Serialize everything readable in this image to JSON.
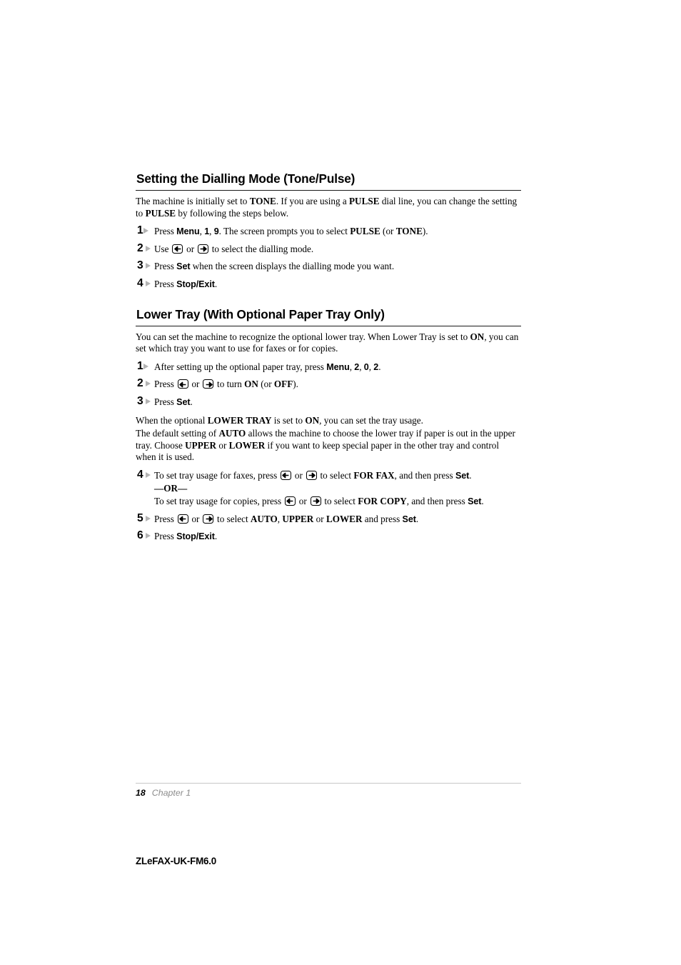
{
  "document": {
    "id_line": "ZLeFAX-UK-FM6.0",
    "footer": {
      "page_number": "18",
      "chapter": "Chapter 1"
    }
  },
  "sections": [
    {
      "heading": "Setting the Dialling Mode (Tone/Pulse)",
      "intro": [
        {
          "parts": [
            {
              "t": "The machine is initially set to ",
              "s": "normal"
            },
            {
              "t": "TONE",
              "s": "bold-serif"
            },
            {
              "t": ". If you are using a ",
              "s": "normal"
            },
            {
              "t": "PULSE",
              "s": "bold-serif"
            },
            {
              "t": " dial line, you can change the setting to ",
              "s": "normal"
            },
            {
              "t": "PULSE",
              "s": "bold-serif"
            },
            {
              "t": " by following the steps below.",
              "s": "normal"
            }
          ]
        }
      ],
      "steps": [
        {
          "num": "1",
          "parts": [
            {
              "t": "Press ",
              "s": "normal"
            },
            {
              "t": "Menu",
              "s": "bold-sans"
            },
            {
              "t": ", ",
              "s": "normal"
            },
            {
              "t": "1",
              "s": "bold-sans"
            },
            {
              "t": ", ",
              "s": "normal"
            },
            {
              "t": "9",
              "s": "bold-sans"
            },
            {
              "t": ". The screen prompts you to select ",
              "s": "normal"
            },
            {
              "t": "PULSE",
              "s": "bold-serif"
            },
            {
              "t": " (or ",
              "s": "normal"
            },
            {
              "t": "TONE",
              "s": "bold-serif"
            },
            {
              "t": ").",
              "s": "normal"
            }
          ]
        },
        {
          "num": "2",
          "parts": [
            {
              "t": "Use ",
              "s": "normal"
            },
            {
              "t": "",
              "s": "key-left"
            },
            {
              "t": " or ",
              "s": "normal"
            },
            {
              "t": "",
              "s": "key-right"
            },
            {
              "t": " to select the dialling mode.",
              "s": "normal"
            }
          ]
        },
        {
          "num": "3",
          "parts": [
            {
              "t": "Press ",
              "s": "normal"
            },
            {
              "t": "Set",
              "s": "bold-sans"
            },
            {
              "t": " when the screen displays the dialling mode you want.",
              "s": "normal"
            }
          ]
        },
        {
          "num": "4",
          "parts": [
            {
              "t": "Press ",
              "s": "normal"
            },
            {
              "t": "Stop/Exit",
              "s": "bold-sans"
            },
            {
              "t": ".",
              "s": "normal"
            }
          ]
        }
      ]
    },
    {
      "heading": "Lower Tray (With Optional Paper Tray Only)",
      "intro": [
        {
          "parts": [
            {
              "t": "You can set the machine to recognize the optional lower tray. When Lower Tray is set to",
              "s": "normal"
            },
            {
              "t": " ON",
              "s": "bold-serif"
            },
            {
              "t": ", you can set which tray you want to use for faxes or for copies.",
              "s": "normal"
            }
          ]
        }
      ],
      "steps": [
        {
          "num": "1",
          "parts": [
            {
              "t": "After setting up the optional paper tray, press ",
              "s": "normal"
            },
            {
              "t": "Menu",
              "s": "bold-sans"
            },
            {
              "t": ", ",
              "s": "normal"
            },
            {
              "t": "2",
              "s": "bold-sans"
            },
            {
              "t": ", ",
              "s": "normal"
            },
            {
              "t": "0",
              "s": "bold-sans"
            },
            {
              "t": ", ",
              "s": "normal"
            },
            {
              "t": "2",
              "s": "bold-sans"
            },
            {
              "t": ".",
              "s": "normal"
            }
          ]
        },
        {
          "num": "2",
          "parts": [
            {
              "t": "Press ",
              "s": "normal"
            },
            {
              "t": "",
              "s": "key-left"
            },
            {
              "t": " or ",
              "s": "normal"
            },
            {
              "t": "",
              "s": "key-right"
            },
            {
              "t": " to turn ",
              "s": "normal"
            },
            {
              "t": "ON",
              "s": "bold-serif"
            },
            {
              "t": " (or ",
              "s": "normal"
            },
            {
              "t": "OFF",
              "s": "bold-serif"
            },
            {
              "t": ").",
              "s": "normal"
            }
          ]
        },
        {
          "num": "3",
          "parts": [
            {
              "t": "Press ",
              "s": "normal"
            },
            {
              "t": "Set",
              "s": "bold-sans"
            },
            {
              "t": ".",
              "s": "normal"
            }
          ]
        }
      ],
      "mid_paragraphs": [
        {
          "parts": [
            {
              "t": "When the optional ",
              "s": "normal"
            },
            {
              "t": "LOWER TRAY",
              "s": "bold-serif"
            },
            {
              "t": " is set to ",
              "s": "normal"
            },
            {
              "t": "ON",
              "s": "bold-serif"
            },
            {
              "t": ", you can set the tray usage.",
              "s": "normal"
            }
          ]
        },
        {
          "parts": [
            {
              "t": "The default setting of ",
              "s": "normal"
            },
            {
              "t": "AUTO",
              "s": "bold-serif"
            },
            {
              "t": " allows the machine to choose the lower tray if paper is out in the upper tray. Choose ",
              "s": "normal"
            },
            {
              "t": "UPPER",
              "s": "bold-serif"
            },
            {
              "t": " or ",
              "s": "normal"
            },
            {
              "t": "LOWER",
              "s": "bold-serif"
            },
            {
              "t": " if you want to keep special paper in the other tray and control when it is used.",
              "s": "normal"
            }
          ]
        }
      ],
      "steps2": [
        {
          "num": "4",
          "parts": [
            {
              "t": "To set tray usage for faxes, press ",
              "s": "normal"
            },
            {
              "t": "",
              "s": "key-left"
            },
            {
              "t": " or ",
              "s": "normal"
            },
            {
              "t": "",
              "s": "key-right"
            },
            {
              "t": " to select ",
              "s": "normal"
            },
            {
              "t": "FOR FAX",
              "s": "bold-serif"
            },
            {
              "t": ", and then press ",
              "s": "normal"
            },
            {
              "t": "Set",
              "s": "bold-sans"
            },
            {
              "t": ".",
              "s": "normal"
            }
          ],
          "or_label": "—OR—",
          "sub_parts": [
            {
              "t": "To set tray usage for copies, press ",
              "s": "normal"
            },
            {
              "t": "",
              "s": "key-left"
            },
            {
              "t": " or ",
              "s": "normal"
            },
            {
              "t": "",
              "s": "key-right"
            },
            {
              "t": " to select ",
              "s": "normal"
            },
            {
              "t": "FOR COPY",
              "s": "bold-serif"
            },
            {
              "t": ", and then press ",
              "s": "normal"
            },
            {
              "t": "Set",
              "s": "bold-sans"
            },
            {
              "t": ".",
              "s": "normal"
            }
          ]
        },
        {
          "num": "5",
          "parts": [
            {
              "t": "Press ",
              "s": "normal"
            },
            {
              "t": "",
              "s": "key-left"
            },
            {
              "t": " or ",
              "s": "normal"
            },
            {
              "t": "",
              "s": "key-right"
            },
            {
              "t": " to select ",
              "s": "normal"
            },
            {
              "t": "AUTO",
              "s": "bold-serif"
            },
            {
              "t": ", ",
              "s": "normal"
            },
            {
              "t": "UPPER",
              "s": "bold-serif"
            },
            {
              "t": " or ",
              "s": "normal"
            },
            {
              "t": "LOWER",
              "s": "bold-serif"
            },
            {
              "t": " and press ",
              "s": "normal"
            },
            {
              "t": "Set",
              "s": "bold-sans"
            },
            {
              "t": ".",
              "s": "normal"
            }
          ]
        },
        {
          "num": "6",
          "parts": [
            {
              "t": "Press ",
              "s": "normal"
            },
            {
              "t": "Stop/Exit",
              "s": "bold-sans"
            },
            {
              "t": ".",
              "s": "normal"
            }
          ]
        }
      ]
    }
  ],
  "icons": {
    "key_left": "left-arrow-key-icon",
    "key_right": "right-arrow-key-icon",
    "step_marker": "step-marker-arrow-icon"
  },
  "colors": {
    "text": "#000000",
    "heading_rule": "#1a1a1a",
    "footer_rule": "#c8c8c8",
    "chapter_label": "#8c8c8c",
    "step_marker": "#b3b3b3"
  }
}
